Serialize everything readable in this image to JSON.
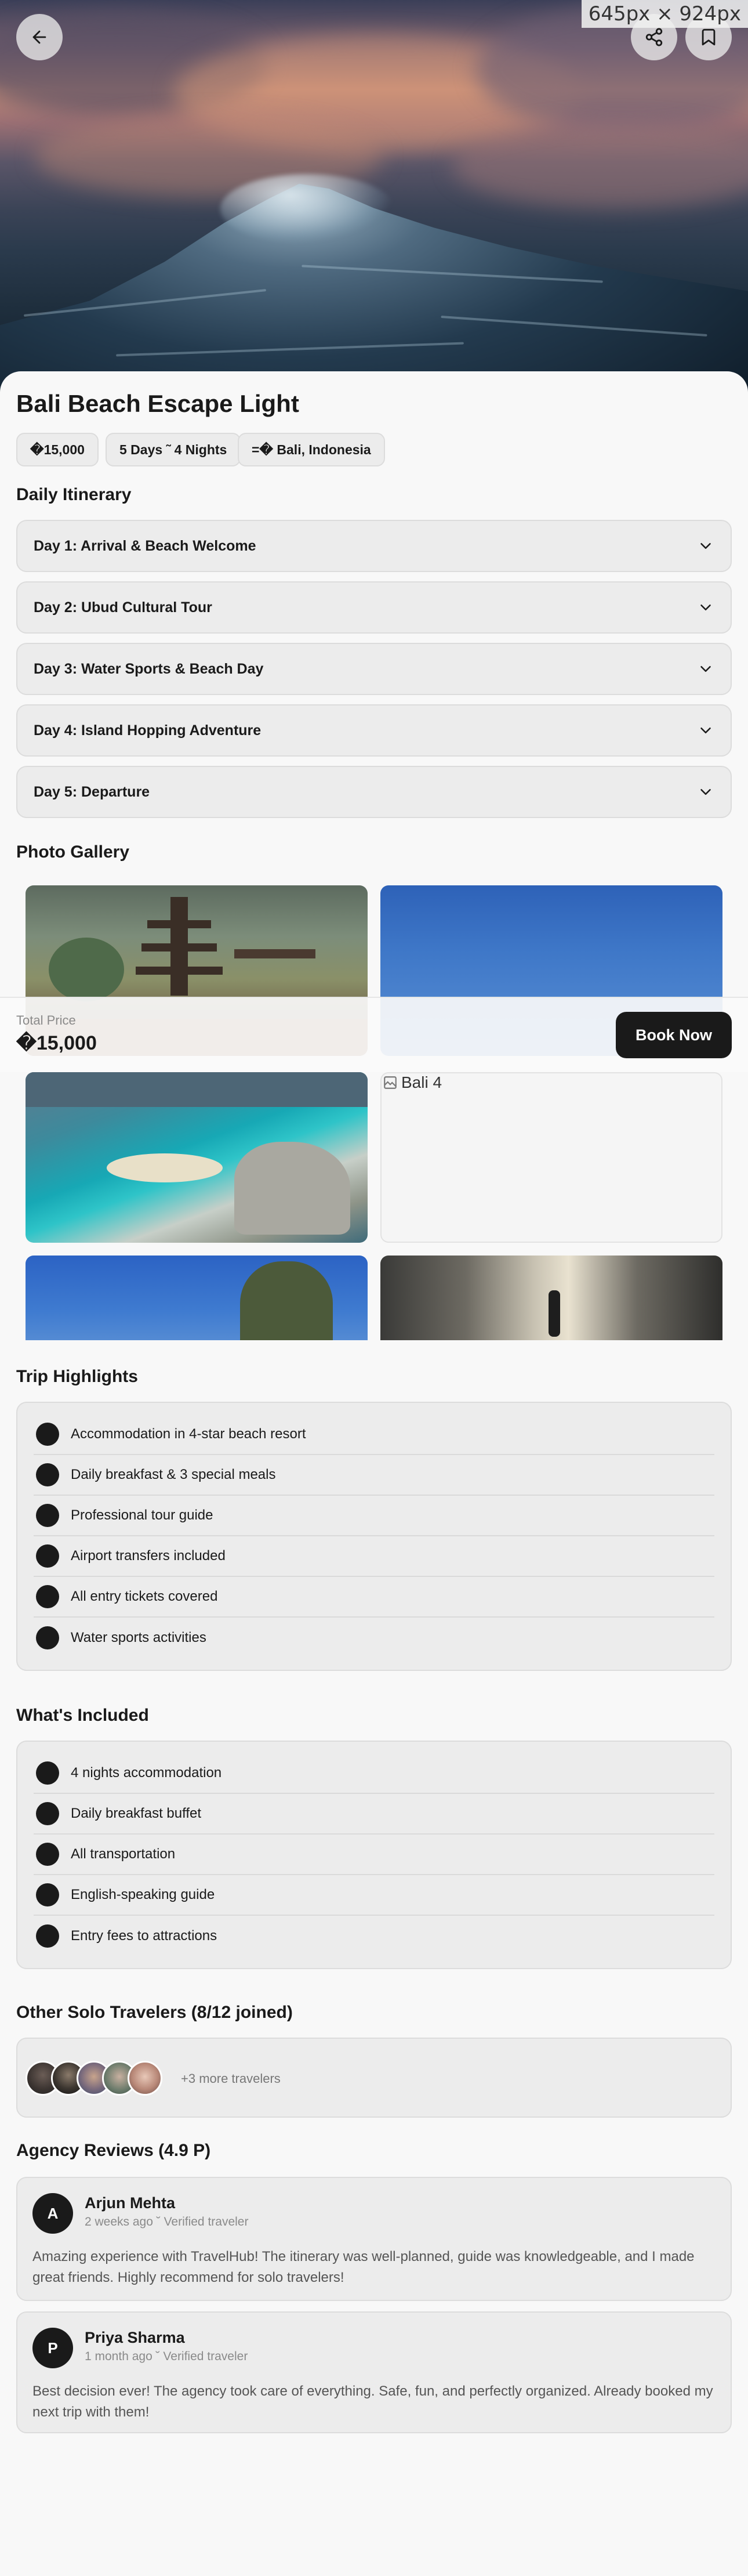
{
  "viewport_badge": "645px × 924px",
  "trip": {
    "title": "Bali Beach Escape Light",
    "price": "�15,000",
    "duration": "5 Days ˜ 4 Nights",
    "location": "=� Bali, Indonesia"
  },
  "itinerary": {
    "heading": "Daily Itinerary",
    "days": [
      {
        "label": "Day 1: Arrival & Beach Welcome"
      },
      {
        "label": "Day 2: Ubud Cultural Tour"
      },
      {
        "label": "Day 3: Water Sports & Beach Day"
      },
      {
        "label": "Day 4: Island Hopping Adventure"
      },
      {
        "label": "Day 5: Departure"
      }
    ]
  },
  "gallery": {
    "heading": "Photo Gallery",
    "broken_image_alt": "Bali 4"
  },
  "booking": {
    "total_label": "Total Price",
    "total_value": "�15,000",
    "button_label": "Book Now"
  },
  "highlights": {
    "heading": "Trip Highlights",
    "items": [
      "Accommodation in 4-star beach resort",
      "Daily breakfast & 3 special meals",
      "Professional tour guide",
      "Airport transfers included",
      "All entry tickets covered",
      "Water sports activities"
    ]
  },
  "included": {
    "heading": "What's Included",
    "items": [
      "4 nights accommodation",
      "Daily breakfast buffet",
      "All transportation",
      "English-speaking guide",
      "Entry fees to attractions"
    ]
  },
  "travelers": {
    "heading": "Other Solo Travelers (8/12 joined)",
    "more_text": "+3 more travelers"
  },
  "reviews": {
    "heading": "Agency Reviews (4.9 P)",
    "items": [
      {
        "initial": "A",
        "name": "Arjun Mehta",
        "meta": "2 weeks ago ˘ Verified traveler",
        "text": "Amazing experience with TravelHub! The itinerary was well-planned, guide was knowledgeable, and I made great friends. Highly recommend for solo travelers!"
      },
      {
        "initial": "P",
        "name": "Priya Sharma",
        "meta": "1 month ago ˘ Verified traveler",
        "text": "Best decision ever! The agency took care of everything. Safe, fun, and perfectly organized. Already booked my next trip with them!"
      }
    ]
  }
}
